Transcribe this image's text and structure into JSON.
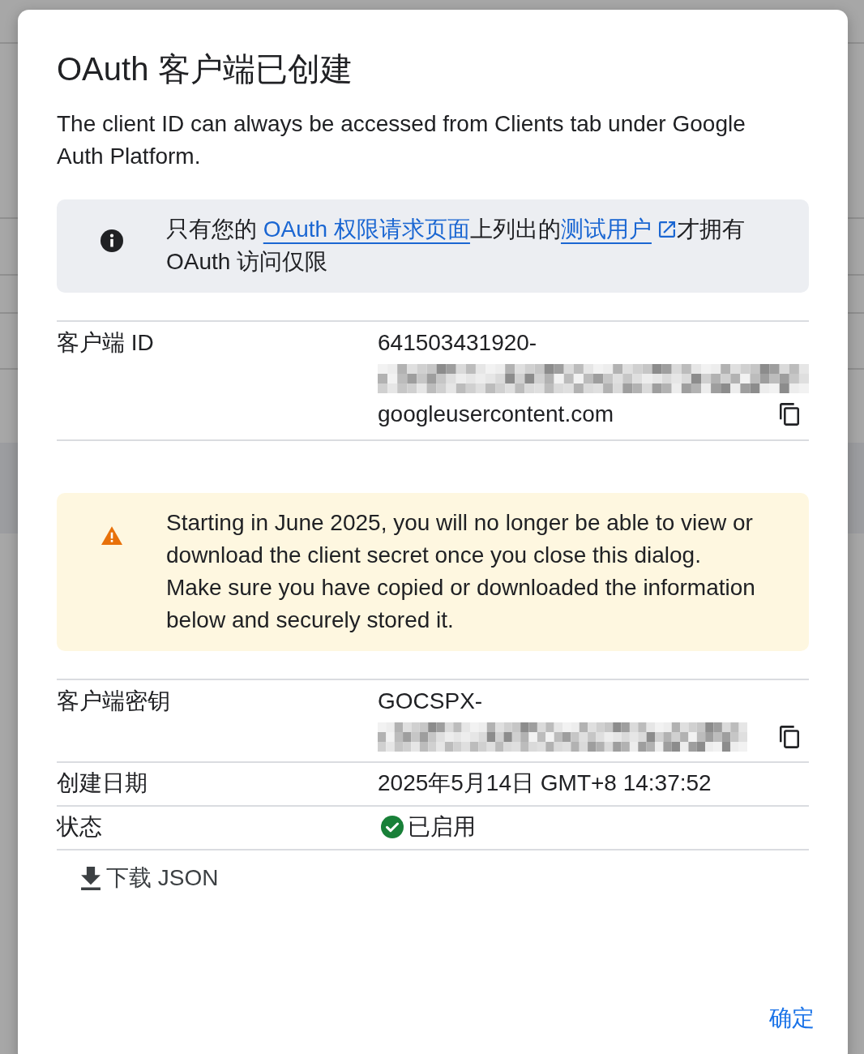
{
  "dialog": {
    "title": "OAuth 客户端已创建",
    "description": "The client ID can always be accessed from Clients tab under Google Auth Platform."
  },
  "info_notice": {
    "parts": [
      {
        "kind": "text",
        "text": "只有您的 "
      },
      {
        "kind": "link",
        "text": "OAuth 权限请求页面",
        "external": false
      },
      {
        "kind": "text",
        "text": "上列出的"
      },
      {
        "kind": "link",
        "text": "测试用户",
        "external": true
      },
      {
        "kind": "text",
        "text": "才拥有 OAuth 访问仅限"
      }
    ]
  },
  "client_id": {
    "label": "客户端 ID",
    "lines": [
      {
        "kind": "text",
        "text": "641503431920-"
      },
      {
        "kind": "redacted"
      },
      {
        "kind": "text",
        "text": "googleusercontent.com"
      }
    ],
    "copyable": true
  },
  "warning_notice": {
    "text": "Starting in June 2025, you will no longer be able to view or download the client secret once you close this dialog. Make sure you have copied or downloaded the information below and securely stored it."
  },
  "details": [
    {
      "kind": "copyable",
      "label": "客户端密钥",
      "lines": [
        {
          "kind": "text",
          "text": "GOCSPX-"
        },
        {
          "kind": "redacted"
        }
      ],
      "copyable": true
    },
    {
      "kind": "plain",
      "label": "创建日期",
      "value": "2025年5月14日 GMT+8 14:37:52"
    },
    {
      "kind": "status",
      "label": "状态",
      "value": "已启用",
      "enabled": true
    }
  ],
  "actions": {
    "download": "下载 JSON",
    "confirm": "确定"
  }
}
